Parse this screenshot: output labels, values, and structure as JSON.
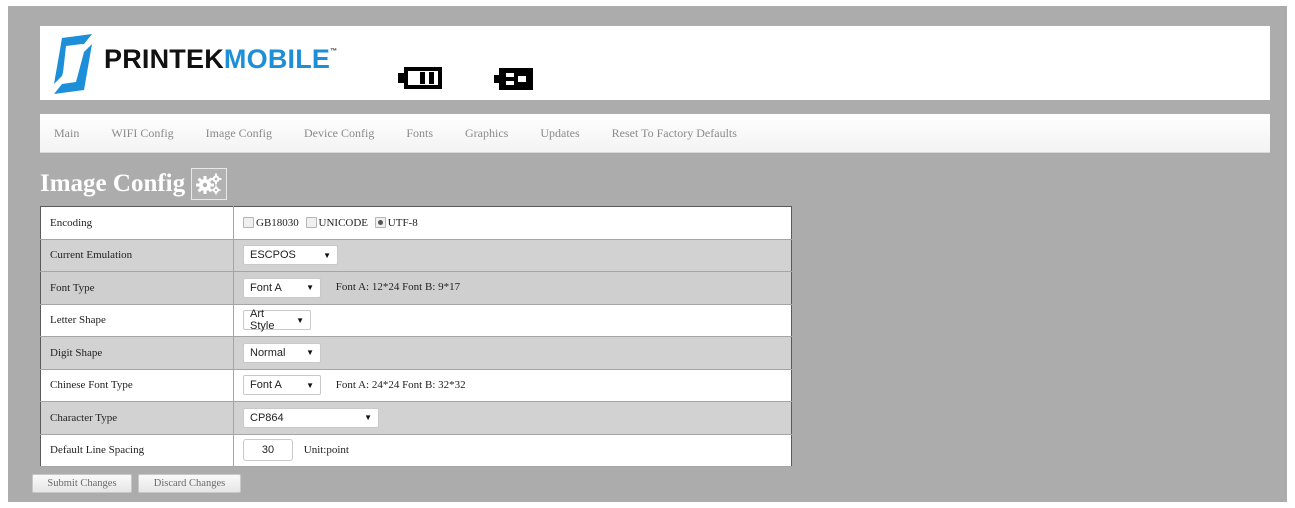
{
  "brand": {
    "word1": "PRINTEK",
    "word2": "MOBILE",
    "tm": "™",
    "colors": {
      "blue": "#1d8fd8",
      "dark": "#111111"
    }
  },
  "header_icons": [
    "battery-icon",
    "power-plug-icon"
  ],
  "nav": {
    "items": [
      {
        "label": "Main"
      },
      {
        "label": "WIFI Config"
      },
      {
        "label": "Image Config"
      },
      {
        "label": "Device Config"
      },
      {
        "label": "Fonts"
      },
      {
        "label": "Graphics"
      },
      {
        "label": "Updates"
      },
      {
        "label": "Reset To Factory Defaults"
      }
    ]
  },
  "page": {
    "title": "Image Config",
    "title_icon": "gears-icon"
  },
  "rows": {
    "encoding": {
      "label": "Encoding",
      "options": [
        {
          "label": "GB18030",
          "checked": false
        },
        {
          "label": "UNICODE",
          "checked": false
        },
        {
          "label": "UTF-8",
          "checked": true
        }
      ]
    },
    "emulation": {
      "label": "Current Emulation",
      "value": "ESCPOS"
    },
    "font_type": {
      "label": "Font Type",
      "value": "Font A",
      "hint": "Font A: 12*24  Font B: 9*17"
    },
    "letter_shape": {
      "label": "Letter Shape",
      "value": "Art Style"
    },
    "digit_shape": {
      "label": "Digit Shape",
      "value": "Normal"
    },
    "chinese_font": {
      "label": "Chinese Font Type",
      "value": "Font A",
      "hint": "Font A: 24*24  Font B: 32*32"
    },
    "char_type": {
      "label": "Character Type",
      "value": "CP864"
    },
    "line_spacing": {
      "label": "Default Line Spacing",
      "value": "30",
      "unit": "Unit:point"
    }
  },
  "buttons": {
    "submit": "Submit Changes",
    "discard": "Discard Changes"
  }
}
